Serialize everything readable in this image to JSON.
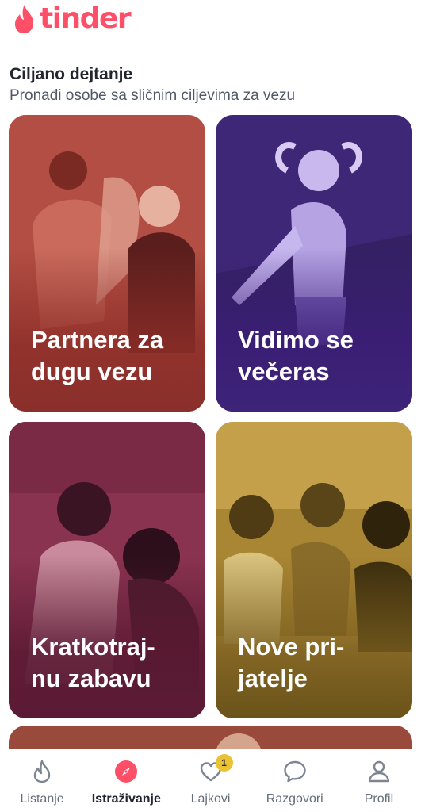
{
  "app": {
    "logo_text": "tinder",
    "brand_color": "#fd5068"
  },
  "section": {
    "title": "Ciljano dejtanje",
    "subtitle": "Pronađi osobe sa sličnim ciljevima za vezu"
  },
  "cards": [
    {
      "label": "Partnera za\ndugu vezu",
      "color": "#a8473e"
    },
    {
      "label": "Vidimo se\nvečeras",
      "color": "#4b2f8a"
    },
    {
      "label": "Kratkotraj-\nnu zabavu",
      "color": "#7a2a45"
    },
    {
      "label": "Nove pri-\njatelje",
      "color": "#b48f3a"
    }
  ],
  "nav": {
    "items": [
      {
        "label": "Listanje",
        "icon": "flame-icon"
      },
      {
        "label": "Istraživanje",
        "icon": "compass-icon",
        "active": true
      },
      {
        "label": "Lajkovi",
        "icon": "heart-icon",
        "badge": "1"
      },
      {
        "label": "Razgovori",
        "icon": "chat-bubble-icon"
      },
      {
        "label": "Profil",
        "icon": "person-icon"
      }
    ]
  }
}
